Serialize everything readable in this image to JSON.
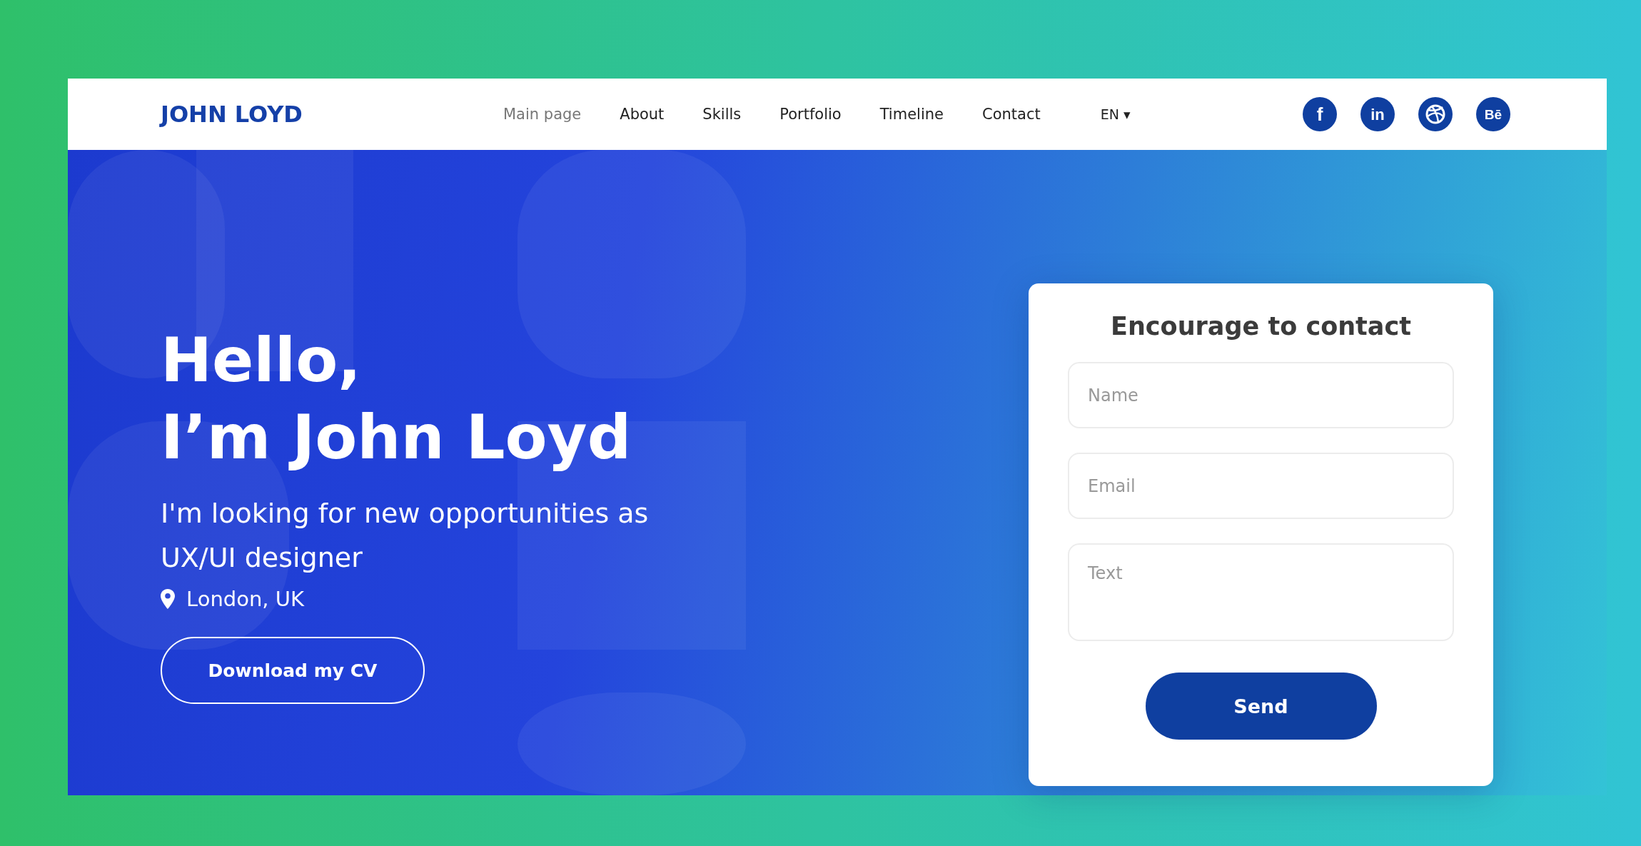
{
  "header": {
    "logo": "JOHN LOYD",
    "nav": [
      {
        "label": "Main page",
        "selected": true
      },
      {
        "label": "About",
        "selected": false
      },
      {
        "label": "Skills",
        "selected": false
      },
      {
        "label": "Portfolio",
        "selected": false
      },
      {
        "label": "Timeline",
        "selected": false
      },
      {
        "label": "Contact",
        "selected": false
      }
    ],
    "language": {
      "label": "EN",
      "caret": "▾"
    },
    "social": [
      {
        "kind": "facebook",
        "glyph": "f"
      },
      {
        "kind": "linkedin",
        "glyph": "in"
      },
      {
        "kind": "dribbble"
      },
      {
        "kind": "behance",
        "glyph": "Bē"
      }
    ]
  },
  "hero": {
    "greeting": "Hello,",
    "name": "I’m John Loyd",
    "tagline": "I'm looking for new opportunities as UX/UI designer",
    "location": "London, UK",
    "button": "Download my CV"
  },
  "contact_form": {
    "title": "Encourage to contact",
    "fields": [
      {
        "kind": "input",
        "placeholder": "Name"
      },
      {
        "kind": "input",
        "placeholder": "Email"
      },
      {
        "kind": "textarea",
        "placeholder": "Text"
      }
    ],
    "button": "Send"
  }
}
